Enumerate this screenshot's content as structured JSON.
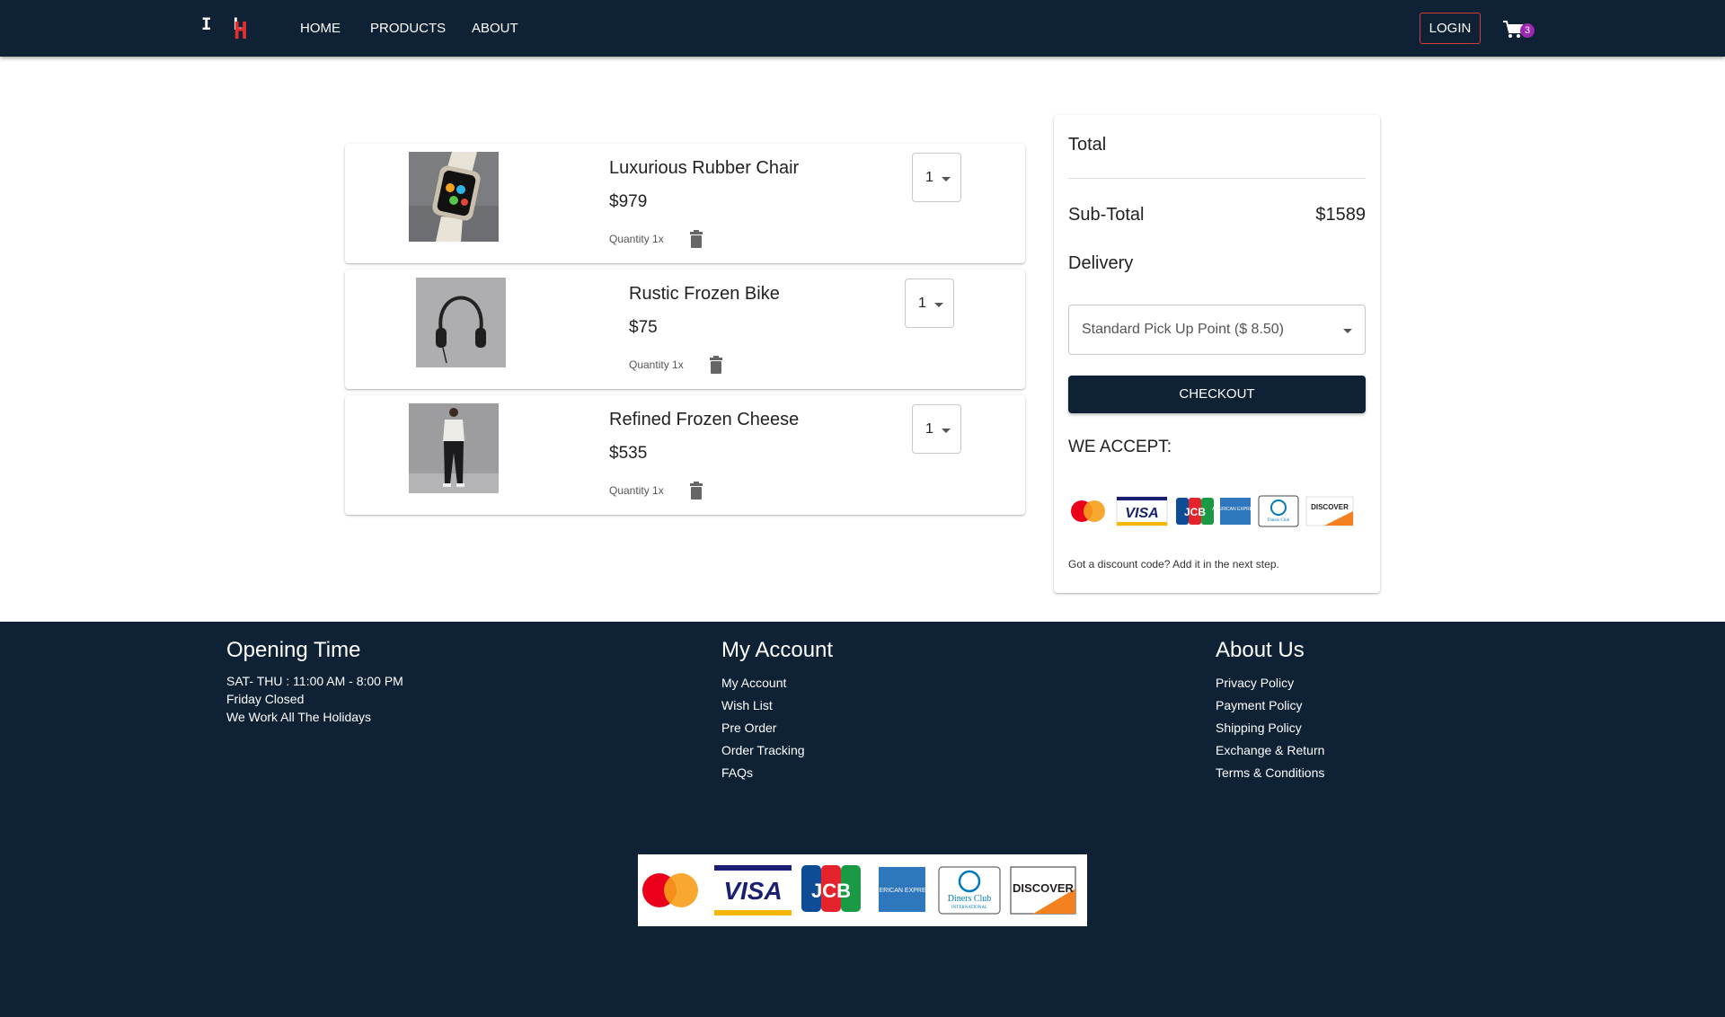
{
  "header": {
    "logo": {
      "text_1": "I L",
      "text_2": "H"
    },
    "nav": [
      "HOME",
      "PRODUCTS",
      "ABOUT"
    ],
    "login_label": "LOGIN",
    "cart_count": "3"
  },
  "cart": {
    "items": [
      {
        "name": "Luxurious Rubber Chair",
        "price": "$979",
        "quantity_text": "Quantity 1x",
        "qty_value": "1",
        "image": "smartwatch"
      },
      {
        "name": "Rustic Frozen Bike",
        "price": "$75",
        "quantity_text": "Quantity 1x",
        "qty_value": "1",
        "image": "headphones"
      },
      {
        "name": "Refined Frozen Cheese",
        "price": "$535",
        "quantity_text": "Quantity 1x",
        "qty_value": "1",
        "image": "person"
      }
    ]
  },
  "summary": {
    "title": "Total",
    "subtotal_label": "Sub-Total",
    "subtotal_value": "$1589",
    "delivery_label": "Delivery",
    "delivery_value": "Standard Pick Up Point ($ 8.50)",
    "checkout_label": "CHECKOUT",
    "accept_label": "WE ACCEPT:",
    "discount_text": "Got a discount code? Add it in the next step."
  },
  "payment_logos": {
    "visa": "VISA",
    "jcb": "JCB",
    "amex": "AMERICAN EXPRESS",
    "diners": "Diners Club",
    "diners_sub": "INTERNATIONAL",
    "discover": "DISCOVER"
  },
  "footer": {
    "opening": {
      "title": "Opening Time",
      "lines": [
        "SAT- THU : 11:00 AM - 8:00 PM",
        "Friday Closed",
        "We Work All The Holidays"
      ]
    },
    "account": {
      "title": "My Account",
      "links": [
        "My Account",
        "Wish List",
        "Pre Order",
        "Order Tracking",
        "FAQs"
      ]
    },
    "about": {
      "title": "About Us",
      "links": [
        "Privacy Policy",
        "Payment Policy",
        "Shipping Policy",
        "Exchange & Return",
        "Terms & Conditions"
      ]
    }
  },
  "colors": {
    "navy": "#0e2135",
    "login_border": "#d83a3a",
    "badge": "#9c27b0"
  }
}
